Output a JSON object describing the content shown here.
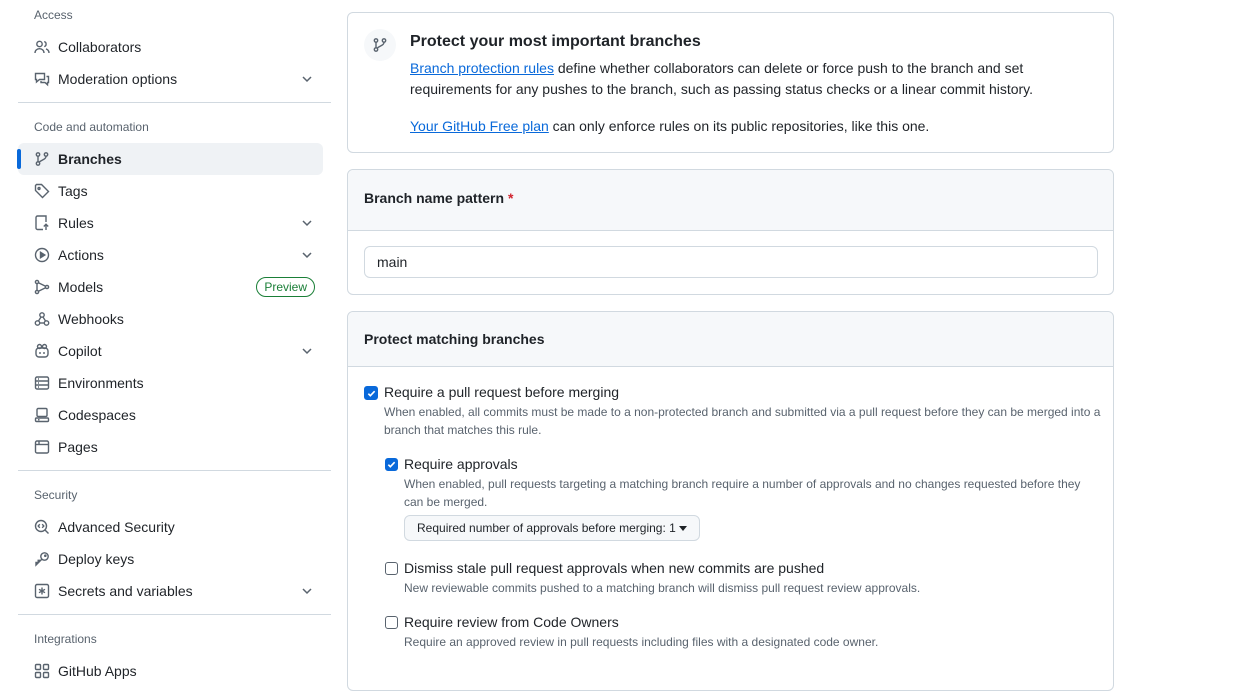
{
  "sidebar": {
    "access_heading": "Access",
    "code_heading": "Code and automation",
    "security_heading": "Security",
    "integrations_heading": "Integrations",
    "items": {
      "collaborators": "Collaborators",
      "moderation": "Moderation options",
      "branches": "Branches",
      "tags": "Tags",
      "rules": "Rules",
      "actions": "Actions",
      "models": "Models",
      "models_badge": "Preview",
      "webhooks": "Webhooks",
      "copilot": "Copilot",
      "environments": "Environments",
      "codespaces": "Codespaces",
      "pages": "Pages",
      "advanced_security": "Advanced Security",
      "deploy_keys": "Deploy keys",
      "secrets": "Secrets and variables",
      "github_apps": "GitHub Apps"
    },
    "active_item": "branches"
  },
  "intro": {
    "icon": "git-branch-icon",
    "title": "Protect your most important branches",
    "rules_link": "Branch protection rules",
    "rules_text": " define whether collaborators can delete or force push to the branch and set requirements for any pushes to the branch, such as passing status checks or a linear commit history.",
    "plan_link": "Your GitHub Free plan",
    "plan_text": " can only enforce rules on its public repositories, like this one."
  },
  "pattern": {
    "header": "Branch name pattern",
    "required_mark": "*",
    "value": "main"
  },
  "protect": {
    "header": "Protect matching branches",
    "require_pr": {
      "label": "Require a pull request before merging",
      "checked": true,
      "desc": "When enabled, all commits must be made to a non-protected branch and submitted via a pull request before they can be merged into a branch that matches this rule."
    },
    "require_approvals": {
      "label": "Require approvals",
      "checked": true,
      "desc": "When enabled, pull requests targeting a matching branch require a number of approvals and no changes requested before they can be merged.",
      "select_label": "Required number of approvals before merging: 1"
    },
    "dismiss_stale": {
      "label": "Dismiss stale pull request approvals when new commits are pushed",
      "checked": false,
      "desc": "New reviewable commits pushed to a matching branch will dismiss pull request review approvals."
    },
    "code_owners": {
      "label": "Require review from Code Owners",
      "checked": false,
      "desc": "Require an approved review in pull requests including files with a designated code owner."
    }
  },
  "colors": {
    "accent": "#0969da",
    "success": "#1a7f37",
    "danger": "#d1242f",
    "border": "#d1d9e0"
  }
}
